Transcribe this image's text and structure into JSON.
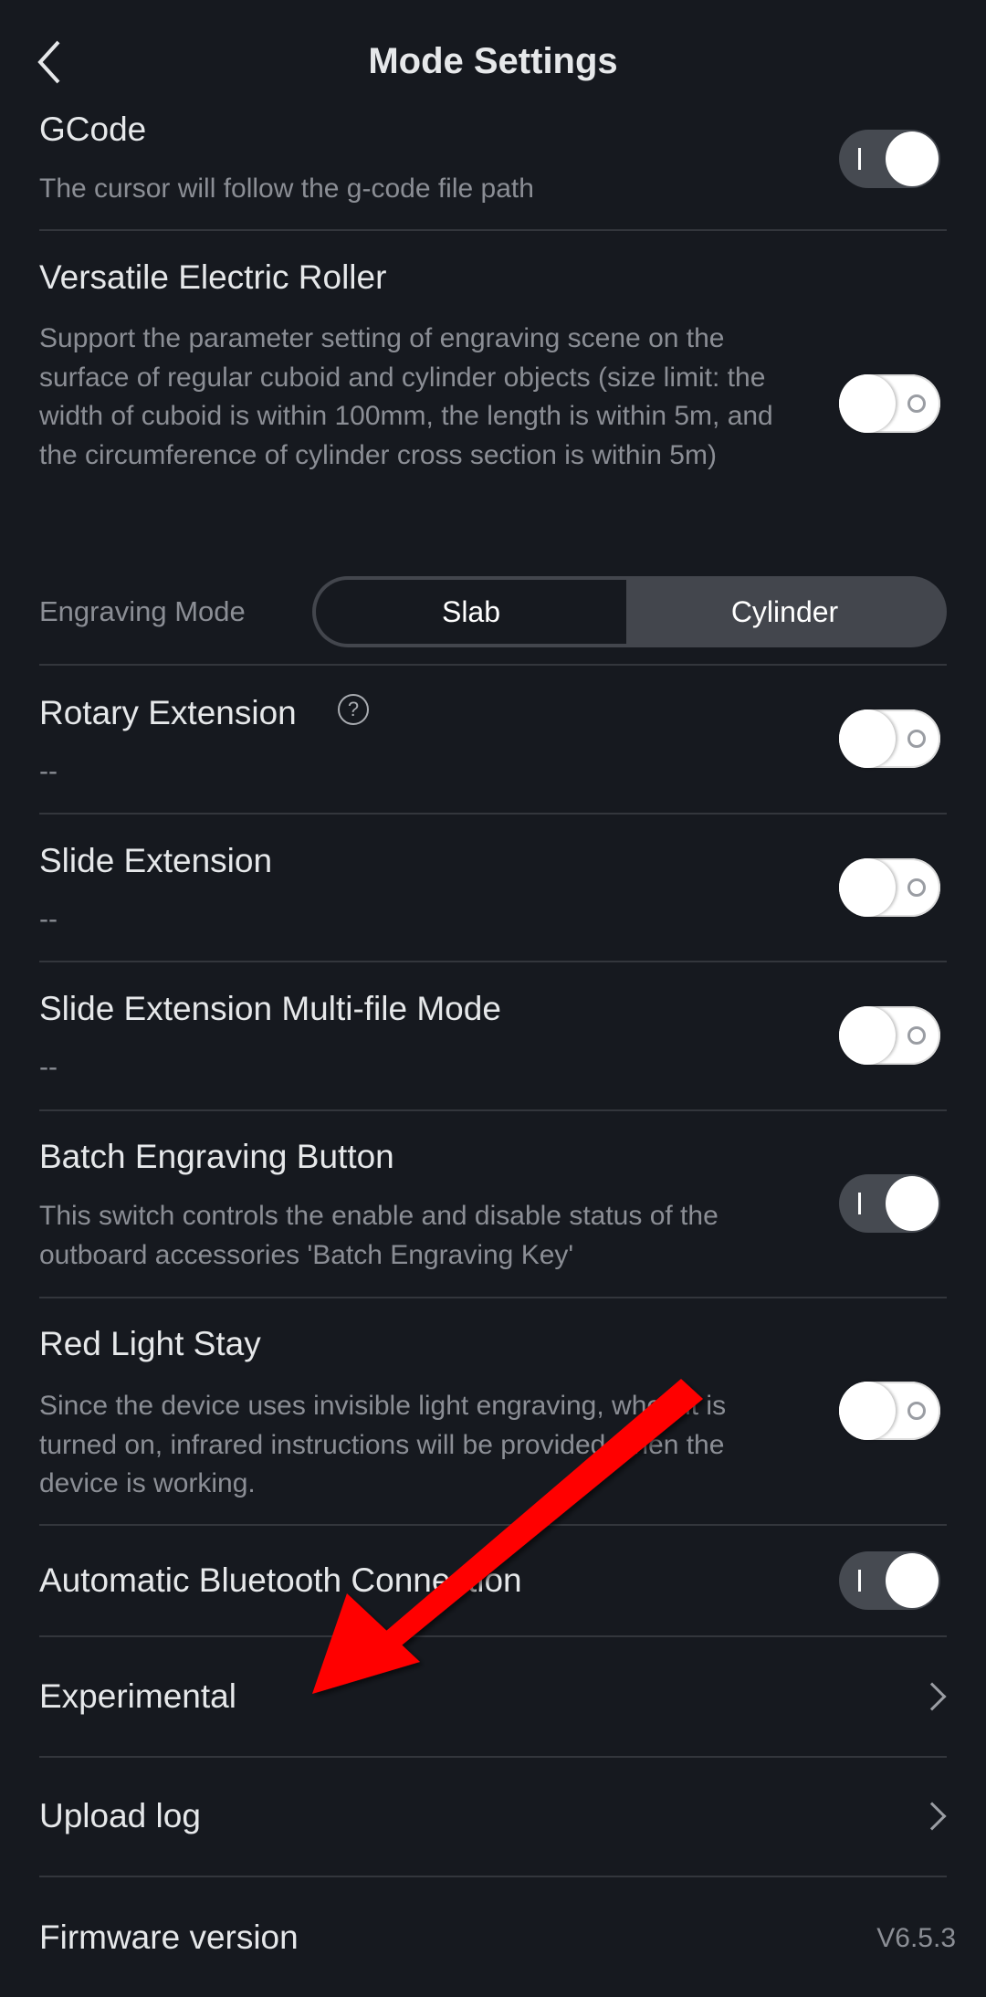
{
  "header": {
    "title": "Mode Settings"
  },
  "rows": {
    "gcode": {
      "title": "GCode",
      "desc": "The cursor will follow the g-code file path",
      "on": true
    },
    "roller": {
      "title": "Versatile Electric Roller",
      "desc": "Support the parameter setting of engraving scene on the surface of regular cuboid and cylinder objects (size limit: the width of cuboid is within 100mm, the length is within 5m, and the circumference of cylinder cross section is within 5m)",
      "on": false
    },
    "engraving_mode": {
      "label": "Engraving Mode",
      "options": [
        "Slab",
        "Cylinder"
      ],
      "selected": "Slab"
    },
    "rotary": {
      "title": "Rotary Extension",
      "desc": "--",
      "on": false
    },
    "slide": {
      "title": "Slide Extension",
      "desc": "--",
      "on": false
    },
    "slide_multi": {
      "title": "Slide Extension Multi-file Mode",
      "desc": "--",
      "on": false
    },
    "batch": {
      "title": "Batch Engraving Button",
      "desc": "This switch controls the enable and disable status of the outboard accessories 'Batch Engraving Key'",
      "on": true
    },
    "red_light": {
      "title": "Red Light Stay",
      "desc": "Since the device uses invisible light engraving, when it is turned on, infrared instructions will be provided when the device is working.",
      "on": false
    },
    "bluetooth": {
      "title": "Automatic Bluetooth Connection",
      "on": true
    },
    "experimental": {
      "title": "Experimental"
    },
    "upload_log": {
      "title": "Upload log"
    },
    "firmware": {
      "title": "Firmware version",
      "value": "V6.5.3"
    }
  },
  "colors": {
    "background": "#16191f",
    "arrow": "#ff0000"
  }
}
